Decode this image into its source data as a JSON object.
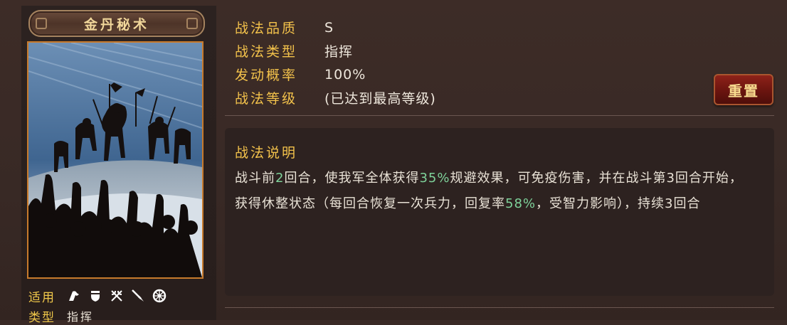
{
  "skill": {
    "name": "金丹秘术",
    "info_rows": [
      {
        "key": "战法品质",
        "value": "S"
      },
      {
        "key": "战法类型",
        "value": "指挥"
      },
      {
        "key": "发动概率",
        "value": "100%"
      },
      {
        "key": "战法等级",
        "value": "(已达到最高等级)"
      }
    ],
    "reset_label": "重置",
    "description": {
      "title": "战法说明",
      "seg1": "战斗前",
      "num1": "2",
      "seg2": "回合，使我军全体获得",
      "num2": "35%",
      "seg3": "规避效果，可免疫伤害，并在战斗第3回合开始，获得休整状态（每回合恢复一次兵力，回复率",
      "num3": "58%",
      "seg4": "，受智力影响），持续3回合"
    },
    "suitable": {
      "label": "适用",
      "icons": [
        "cavalry-icon",
        "shield-icon",
        "crossed-bows-icon",
        "spear-icon",
        "wheel-icon"
      ]
    },
    "trait": {
      "label": "类型",
      "value": "指挥"
    }
  },
  "colors": {
    "gold_label": "#f3c24b",
    "highlight_green": "#7ed29a",
    "reset_red": "#8e2219"
  }
}
